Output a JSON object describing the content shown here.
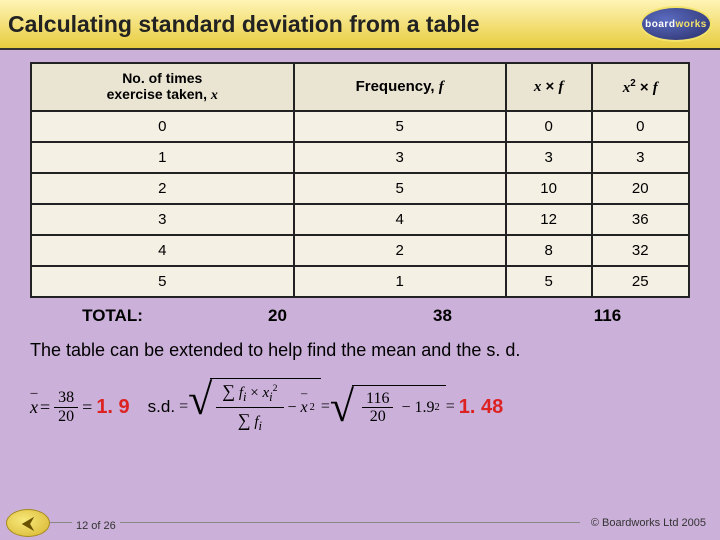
{
  "header": {
    "title": "Calculating standard deviation from a table",
    "logo_first": "board",
    "logo_second": "works"
  },
  "table": {
    "headers": {
      "col1_line1": "No. of times",
      "col1_line2": "exercise taken,",
      "col1_var": "x",
      "col2": "Frequency,",
      "col2_var": "f",
      "col3_a": "x",
      "col3_op": "×",
      "col3_b": "f",
      "col4_a": "x",
      "col4_sup": "2",
      "col4_op": "×",
      "col4_b": "f"
    },
    "rows": [
      {
        "x": "0",
        "f": "5",
        "xf": "0",
        "x2f": "0"
      },
      {
        "x": "1",
        "f": "3",
        "xf": "3",
        "x2f": "3"
      },
      {
        "x": "2",
        "f": "5",
        "xf": "10",
        "x2f": "20"
      },
      {
        "x": "3",
        "f": "4",
        "xf": "12",
        "x2f": "36"
      },
      {
        "x": "4",
        "f": "2",
        "xf": "8",
        "x2f": "32"
      },
      {
        "x": "5",
        "f": "1",
        "xf": "5",
        "x2f": "25"
      }
    ],
    "totals": {
      "label": "TOTAL:",
      "f": "20",
      "xf": "38",
      "x2f": "116"
    }
  },
  "caption": "The table can be extended to help find the mean and the s. d.",
  "formulas": {
    "xbar_sym": "x",
    "eq": "=",
    "mean_num": "38",
    "mean_den": "20",
    "mean_ans": "1. 9",
    "sd_label": "s.d.",
    "sqrt": "√",
    "sd_num_sigma": "∑",
    "sd_num_fi": "f",
    "sd_num_i": "i",
    "sd_num_times": "×",
    "sd_num_xi": "x",
    "sd_num_sq": "2",
    "sd_den_sigma": "∑",
    "sd_den_fi": "f",
    "sd_minus": "−",
    "sd_xbar": "x",
    "sd_xbar_sq": "2",
    "sd_val_num": "116",
    "sd_val_den": "20",
    "sd_val_minus": "−",
    "sd_val_mean": "1.9",
    "sd_val_sq": "2",
    "sd_ans": "1. 48"
  },
  "footer": {
    "arrow": "⮜",
    "page": "12 of 26",
    "copyright": "© Boardworks Ltd 2005"
  },
  "chart_data": {
    "type": "table",
    "title": "Calculating standard deviation from a table",
    "columns": [
      "No. of times exercise taken, x",
      "Frequency, f",
      "x × f",
      "x² × f"
    ],
    "rows": [
      [
        0,
        5,
        0,
        0
      ],
      [
        1,
        3,
        3,
        3
      ],
      [
        2,
        5,
        10,
        20
      ],
      [
        3,
        4,
        12,
        36
      ],
      [
        4,
        2,
        8,
        32
      ],
      [
        5,
        1,
        5,
        25
      ]
    ],
    "totals": {
      "f": 20,
      "xf": 38,
      "x2f": 116
    },
    "mean": 1.9,
    "sd": 1.48
  }
}
